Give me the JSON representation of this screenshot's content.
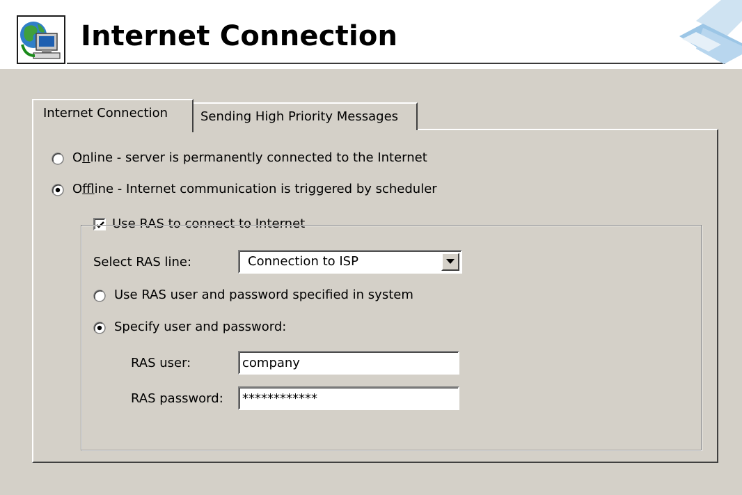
{
  "header": {
    "title": "Internet Connection",
    "icon": "globe-computer-icon",
    "logo": "brand-logo"
  },
  "tabs": [
    {
      "label": "Internet Connection",
      "selected": true
    },
    {
      "label": "Sending High Priority Messages",
      "selected": false
    }
  ],
  "connection_mode": {
    "online": {
      "prefix": "O",
      "accel": "n",
      "rest": "line - server is permanently connected to the Internet",
      "selected": false
    },
    "offline": {
      "prefix": "O",
      "accel": "f",
      "rest": "fline - Internet communication is triggered by scheduler",
      "selected": true
    }
  },
  "ras": {
    "use_ras_label": "Use RAS to connect to Internet",
    "use_ras_checked": true,
    "select_line_label": "Select RAS line:",
    "selected_line": "Connection to ISP",
    "auth_system_label": "Use RAS user and password specified in system",
    "auth_system_selected": false,
    "auth_specify_label": "Specify user and password:",
    "auth_specify_selected": true,
    "user_label": "RAS user:",
    "user_value": "company",
    "password_label": "RAS password:",
    "password_value": "************"
  },
  "colors": {
    "panel_bg": "#d4d0c8",
    "window_bg": "#ffffff",
    "shadow": "#404040",
    "highlight": "#ffffff"
  }
}
